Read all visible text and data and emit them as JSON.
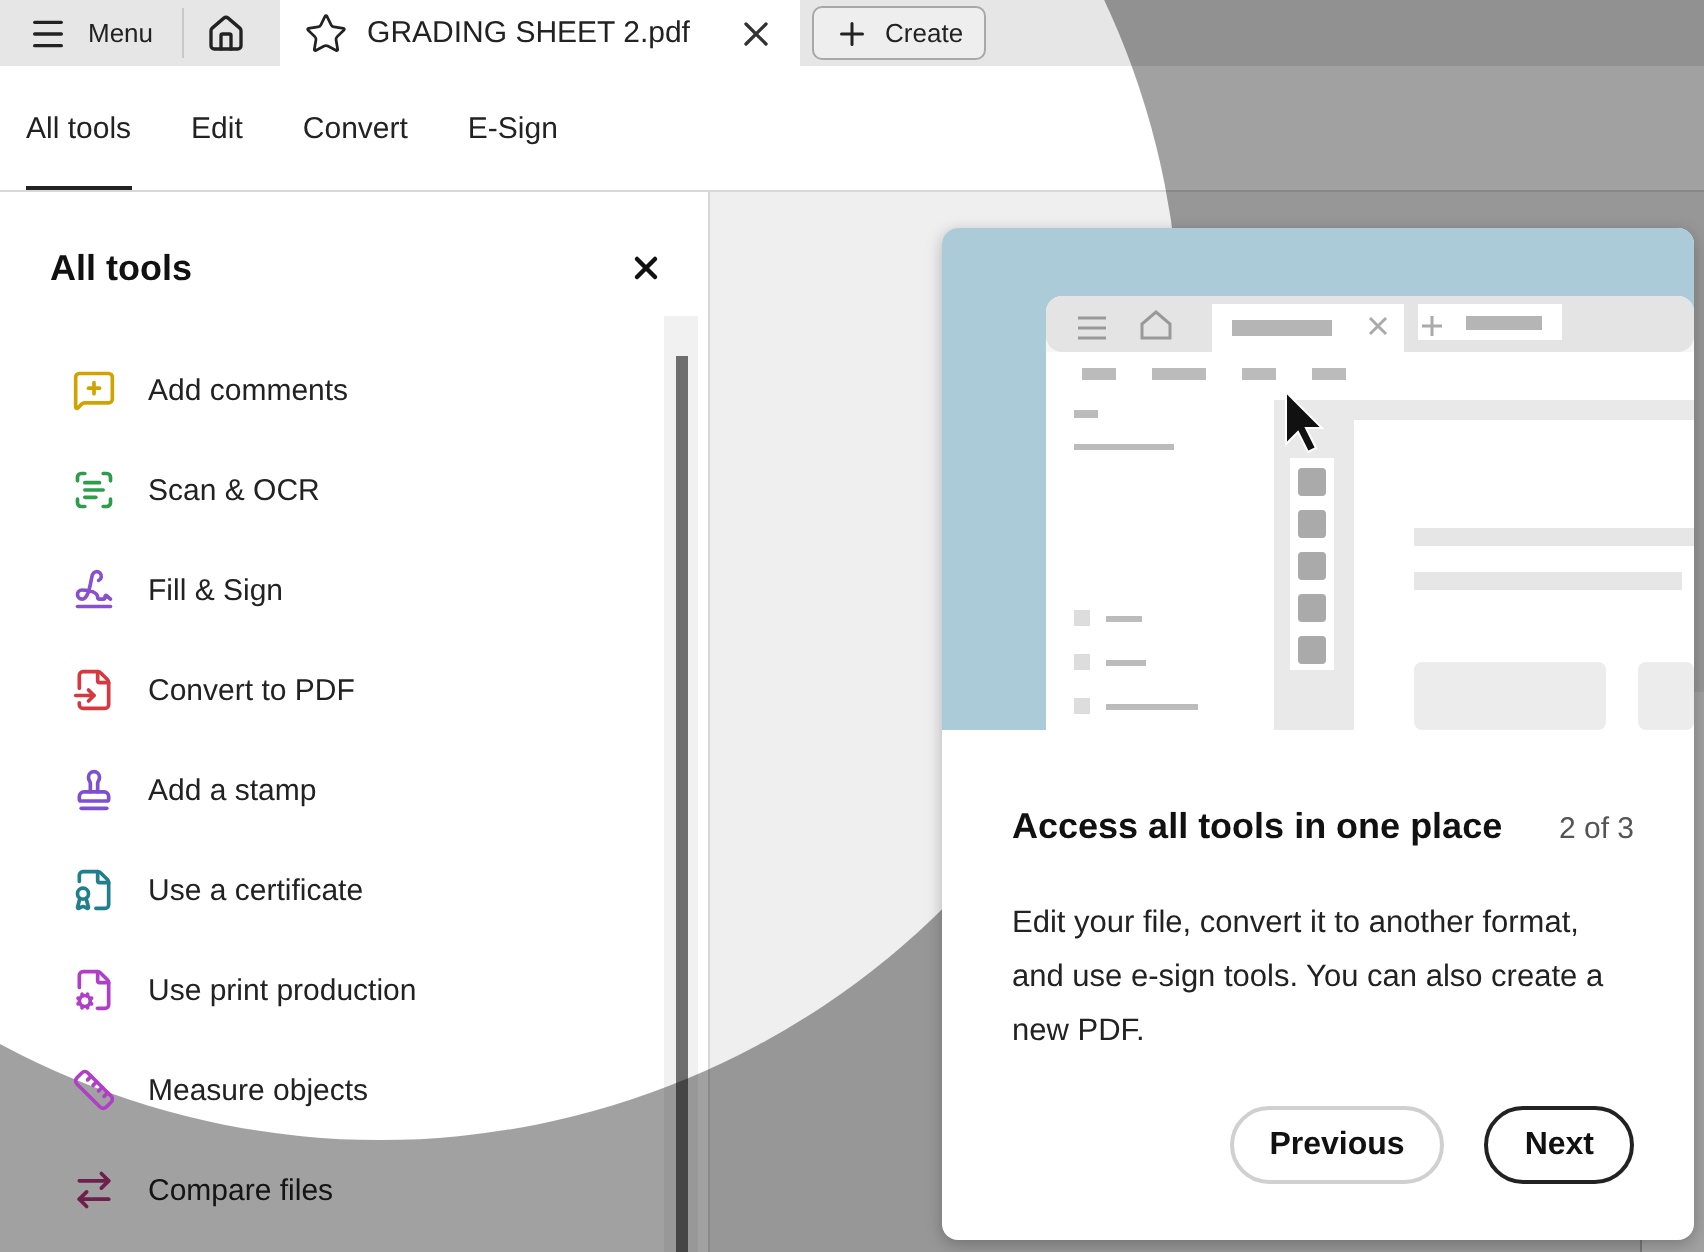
{
  "tab_bar": {
    "menu_label": "Menu",
    "document_tab": {
      "title": "GRADING SHEET 2.pdf",
      "selected": true
    },
    "create_label": "Create"
  },
  "nav_tabs": [
    {
      "label": "All tools",
      "selected": true
    },
    {
      "label": "Edit",
      "selected": false
    },
    {
      "label": "Convert",
      "selected": false
    },
    {
      "label": "E-Sign",
      "selected": false
    }
  ],
  "tools_panel": {
    "title": "All tools",
    "items": [
      {
        "label": "Add comments",
        "kind": "comment",
        "color": "#d1a300"
      },
      {
        "label": "Scan & OCR",
        "kind": "scan",
        "color": "#2d9d4b"
      },
      {
        "label": "Fill & Sign",
        "kind": "sign",
        "color": "#8a4fd0"
      },
      {
        "label": "Convert to PDF",
        "kind": "convert",
        "color": "#d7373f"
      },
      {
        "label": "Add a stamp",
        "kind": "stamp",
        "color": "#7e4fd0"
      },
      {
        "label": "Use a certificate",
        "kind": "certificate",
        "color": "#1f7f8c"
      },
      {
        "label": "Use print production",
        "kind": "print",
        "color": "#b03fc8"
      },
      {
        "label": "Measure objects",
        "kind": "measure",
        "color": "#b03fc8"
      },
      {
        "label": "Compare files",
        "kind": "compare",
        "color": "#6e1f4d"
      }
    ]
  },
  "popup": {
    "title": "Access all tools in one place",
    "step": "2 of 3",
    "body": "Edit your file, convert it to another format, and use e-sign tools. You can also create a new PDF.",
    "buttons": [
      {
        "label": "Previous",
        "kind": "secondary"
      },
      {
        "label": "Next",
        "kind": "primary"
      }
    ]
  }
}
